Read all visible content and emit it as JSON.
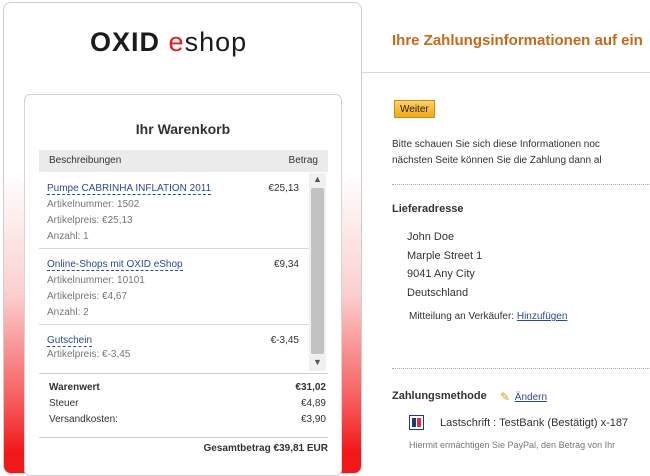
{
  "logo": {
    "part1": "OXID",
    "part2": "e",
    "part3": "shop"
  },
  "cart": {
    "title": "Ihr Warenkorb",
    "header": {
      "description": "Beschreibungen",
      "amount": "Betrag"
    },
    "items": [
      {
        "name": "Pumpe CABRINHA INFLATION 2011",
        "price": "€25,13",
        "article_no": "Artikelnummer: 1502",
        "unit_price": "Artikelpreis: €25,13",
        "quantity": "Anzahl: 1"
      },
      {
        "name": "Online-Shops mit OXID eShop",
        "price": "€9,34",
        "article_no": "Artikelnummer: 10101",
        "unit_price": "Artikelpreis: €4,67",
        "quantity": "Anzahl: 2"
      },
      {
        "name": "Gutschein",
        "price": "€-3,45",
        "unit_price": "Artikelpreis: €-3,45"
      }
    ],
    "scroll": {
      "up": "▲",
      "down": "▼"
    },
    "totals": {
      "goods_label": "Warenwert",
      "goods_value": "€31,02",
      "tax_label": "Steuer",
      "tax_value": "€4,89",
      "shipping_label": "Versandkosten:",
      "shipping_value": "€3,90"
    },
    "grand_total": "Gesamtbetrag €39,81 EUR"
  },
  "right": {
    "title": "Ihre Zahlungsinformationen auf ein",
    "continue_button": "Weiter",
    "info_line1": "Bitte schauen Sie sich diese Informationen noc",
    "info_line2": "nächsten Seite können Sie die Zahlung dann al",
    "delivery": {
      "title": "Lieferadresse",
      "name": "John Doe",
      "street": "Marple Street 1",
      "city": "9041 Any City",
      "country": "Deutschland"
    },
    "seller_note_label": "Mitteilung an Verkäufer:",
    "seller_note_link": "Hinzufügen",
    "payment": {
      "title": "Zahlungsmethode",
      "change_link": "Ändern",
      "icon": "lastschrift-icon",
      "method": "Lastschrift : TestBank (Bestätigt) x-187",
      "sub": "Hiermit ermächtigen Sie PayPal, den Betrag von Ihr"
    }
  }
}
